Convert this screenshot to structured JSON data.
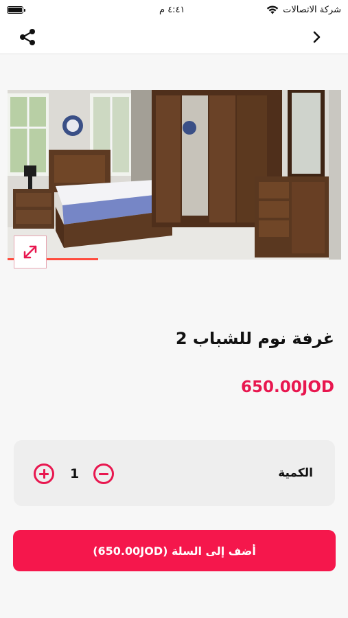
{
  "status_bar": {
    "carrier": "شركة الاتصالات",
    "time": "٤:٤١ م",
    "wifi_icon": "wifi-icon",
    "battery_icon": "battery-icon"
  },
  "navbar": {
    "share_icon": "share-icon",
    "back_icon": "chevron-right-icon"
  },
  "product": {
    "image_alt": "bedroom set product photo",
    "expand_icon": "expand-icon",
    "name": "غرفة نوم للشباب 2",
    "price": "650.00JOD"
  },
  "quantity": {
    "label": "الكمية",
    "value": "1",
    "plus_icon": "plus-circle-icon",
    "minus_icon": "minus-circle-icon"
  },
  "cart": {
    "add_label": "أضف إلى السلة (650.00JOD)"
  },
  "colors": {
    "accent": "#f5174c",
    "price": "#e8174f"
  }
}
